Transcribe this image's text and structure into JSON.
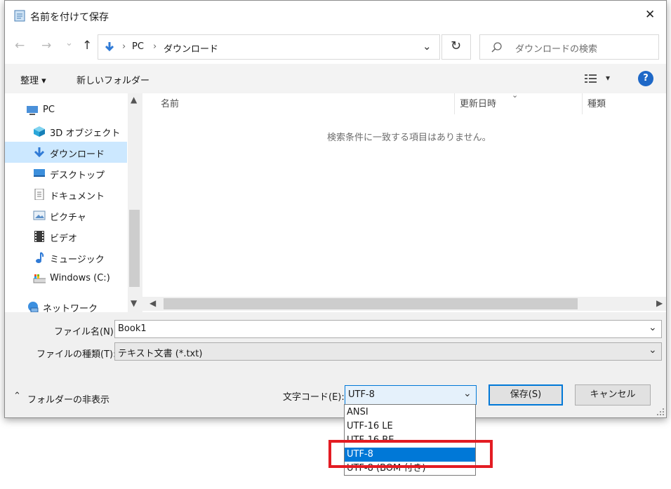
{
  "dialog": {
    "title": "名前を付けて保存",
    "close_glyph": "✕"
  },
  "nav": {
    "back_glyph": "←",
    "forward_glyph": "→",
    "recent_glyph": "⌄",
    "up_glyph": "↑",
    "breadcrumb": [
      "PC",
      "ダウンロード"
    ],
    "separator": "›",
    "dropdown_glyph": "⌄",
    "refresh_glyph": "↻",
    "search_placeholder": "ダウンロードの検索"
  },
  "toolbar": {
    "organize_label": "整理 ▾",
    "new_folder_label": "新しいフォルダー",
    "view_dropdown_glyph": "▾",
    "help_glyph": "?"
  },
  "sidebar": {
    "items": [
      {
        "label": "PC",
        "icon": "pc-icon"
      },
      {
        "label": "3D オブジェクト",
        "icon": "3d-objects-icon"
      },
      {
        "label": "ダウンロード",
        "icon": "download-icon",
        "selected": true
      },
      {
        "label": "デスクトップ",
        "icon": "desktop-icon"
      },
      {
        "label": "ドキュメント",
        "icon": "document-icon"
      },
      {
        "label": "ピクチャ",
        "icon": "pictures-icon"
      },
      {
        "label": "ビデオ",
        "icon": "video-icon"
      },
      {
        "label": "ミュージック",
        "icon": "music-icon"
      },
      {
        "label": "Windows (C:)",
        "icon": "drive-icon"
      },
      {
        "label": "ネットワーク",
        "icon": "network-icon"
      }
    ]
  },
  "filelist": {
    "columns": [
      "名前",
      "更新日時",
      "種類"
    ],
    "empty_message": "検索条件に一致する項目はありません。"
  },
  "form": {
    "filename_label": "ファイル名(N):",
    "filename_value": "Book1",
    "filetype_label": "ファイルの種類(T):",
    "filetype_value": "テキスト文書 (*.txt)",
    "hide_folders_label": "フォルダーの非表示",
    "encoding_label": "文字コード(E):",
    "encoding_value": "UTF-8",
    "save_label": "保存(S)",
    "cancel_label": "キャンセル"
  },
  "encoding_options": [
    {
      "label": "ANSI",
      "selected": false
    },
    {
      "label": "UTF-16 LE",
      "selected": false
    },
    {
      "label": "UTF-16 BE",
      "selected": false
    },
    {
      "label": "UTF-8",
      "selected": true
    },
    {
      "label": "UTF-8 (BOM 付き)",
      "selected": false
    }
  ],
  "colors": {
    "accent": "#0078d7",
    "highlight_box": "#e31c23",
    "selected_nav": "#cce8ff"
  }
}
